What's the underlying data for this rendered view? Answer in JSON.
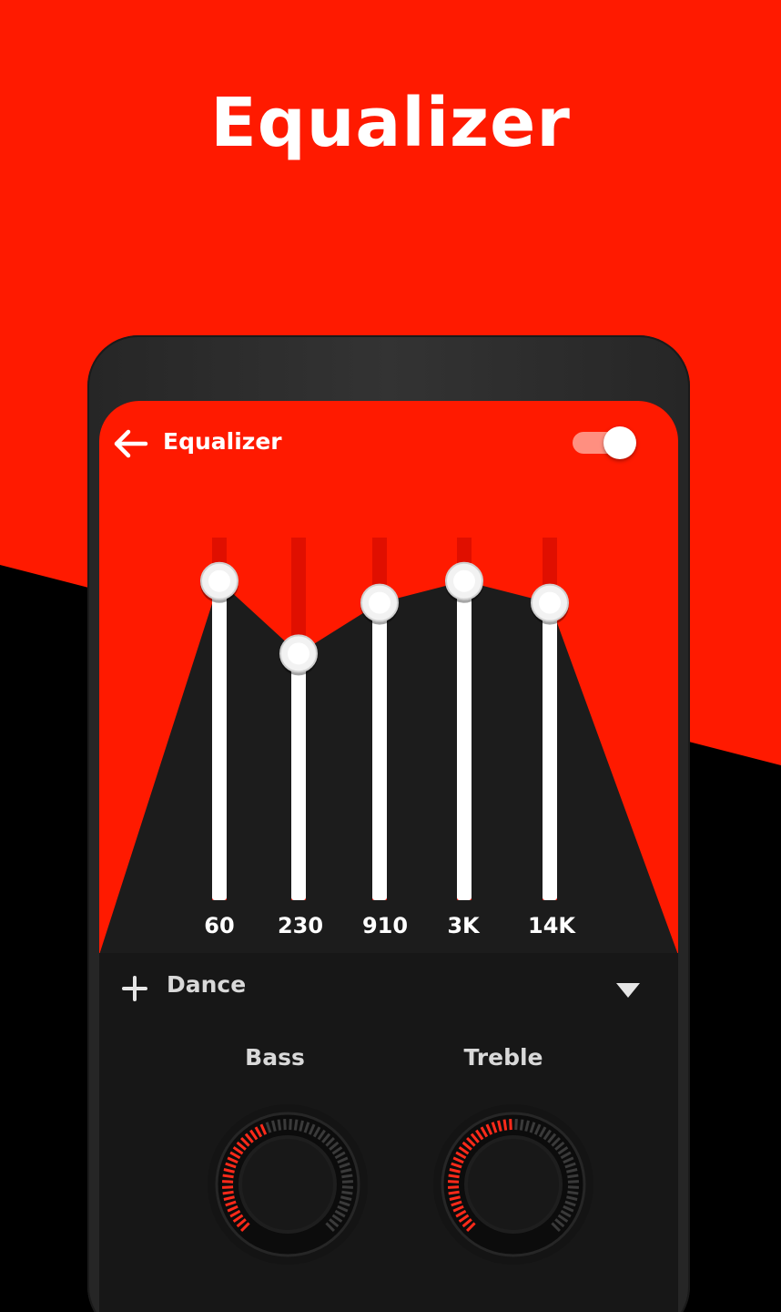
{
  "promo": {
    "title": "Equalizer"
  },
  "colors": {
    "accent": "#ff1a00",
    "dark": "#171717",
    "track_inactive": "#e00f00",
    "knob_tick_on": "#ff2a1a",
    "knob_tick_off": "#3a3a3a"
  },
  "screen": {
    "title": "Equalizer",
    "back_icon": "arrow-left-icon",
    "toggle": {
      "state": "on"
    }
  },
  "equalizer": {
    "bands": [
      {
        "label": "60",
        "level": 0.88
      },
      {
        "label": "230",
        "level": 0.68
      },
      {
        "label": "910",
        "level": 0.82
      },
      {
        "label": "3K",
        "level": 0.88
      },
      {
        "label": "14K",
        "level": 0.82
      }
    ]
  },
  "preset": {
    "icon": "plus-icon",
    "name": "Dance",
    "dropdown_icon": "triangle-down-icon"
  },
  "knobs": [
    {
      "label": "Bass",
      "level": 0.42
    },
    {
      "label": "Treble",
      "level": 0.5
    }
  ]
}
